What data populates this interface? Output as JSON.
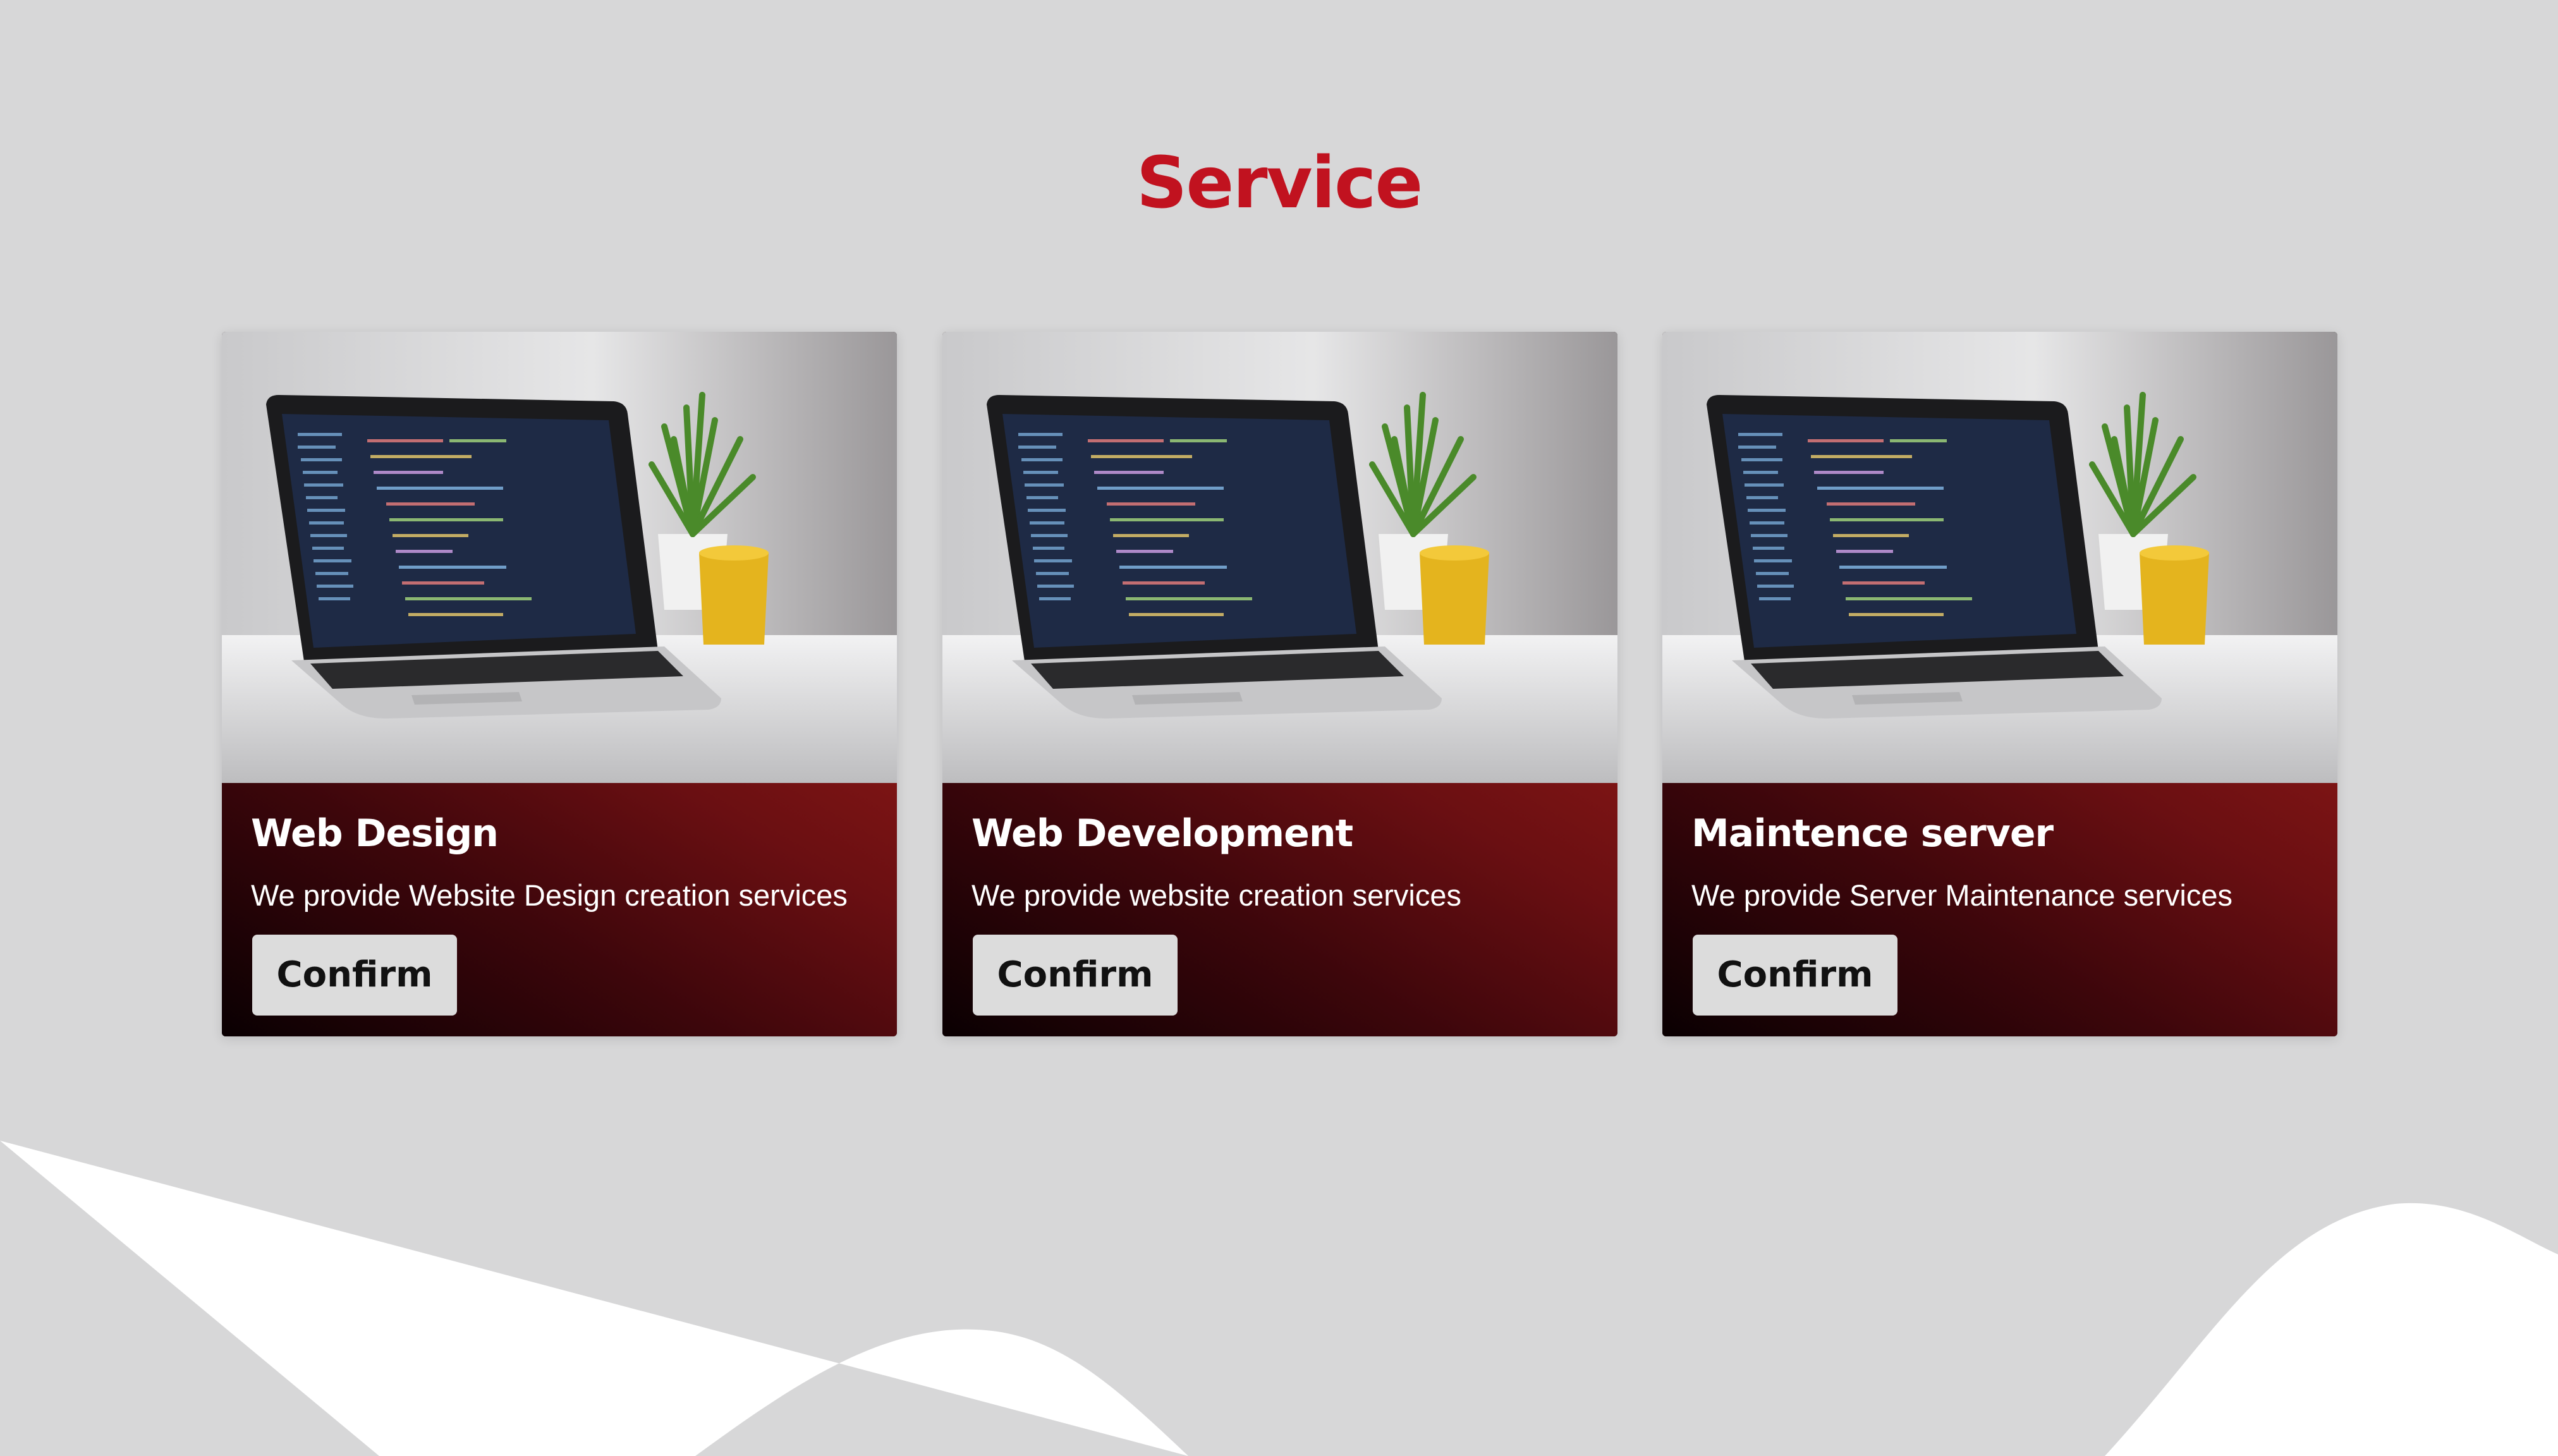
{
  "section": {
    "title": "Service"
  },
  "colors": {
    "title": "#c1121f",
    "background": "#d7d7d8",
    "card_gradient_start": "#0a0002",
    "card_gradient_end": "#7c1414",
    "button": "#dcdcdc"
  },
  "cards": [
    {
      "title": "Web Design",
      "description": "We provide Website Design creation services",
      "button_label": "Confirm",
      "image": "laptop-with-code-and-plant-photo"
    },
    {
      "title": "Web Development",
      "description": "We provide website creation services",
      "button_label": "Confirm",
      "image": "laptop-with-code-and-plant-photo"
    },
    {
      "title": "Maintence server",
      "description": "We provide Server Maintenance services",
      "button_label": "Confirm",
      "image": "laptop-with-code-and-plant-photo"
    }
  ]
}
